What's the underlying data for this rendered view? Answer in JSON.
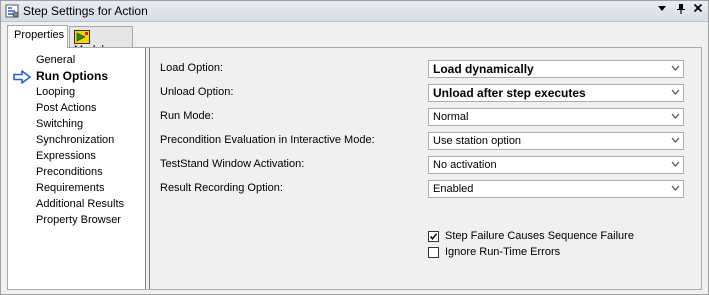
{
  "window": {
    "title": "Step Settings for Action",
    "controls": {
      "dropdown": "▾",
      "pin": "ᚹ",
      "close": "✕"
    }
  },
  "tabs": [
    {
      "label": "Properties",
      "active": true
    },
    {
      "label": "Module",
      "active": false,
      "icon": "labview-module-icon"
    }
  ],
  "nav": {
    "items": [
      {
        "label": "General",
        "selected": false
      },
      {
        "label": "Run Options",
        "selected": true
      },
      {
        "label": "Looping",
        "selected": false
      },
      {
        "label": "Post Actions",
        "selected": false
      },
      {
        "label": "Switching",
        "selected": false
      },
      {
        "label": "Synchronization",
        "selected": false
      },
      {
        "label": "Expressions",
        "selected": false
      },
      {
        "label": "Preconditions",
        "selected": false
      },
      {
        "label": "Requirements",
        "selected": false
      },
      {
        "label": "Additional Results",
        "selected": false
      },
      {
        "label": "Property Browser",
        "selected": false
      }
    ],
    "selected_indicator": "blue-right-arrow-icon"
  },
  "options": [
    {
      "label": "Load Option:",
      "value": "Load dynamically",
      "bold": true
    },
    {
      "label": "Unload Option:",
      "value": "Unload after step executes",
      "bold": true
    },
    {
      "label": "Run Mode:",
      "value": "Normal",
      "bold": false
    },
    {
      "label": "Precondition Evaluation in Interactive Mode:",
      "value": "Use station option",
      "bold": false
    },
    {
      "label": "TestStand Window Activation:",
      "value": "No activation",
      "bold": false
    },
    {
      "label": "Result Recording Option:",
      "value": "Enabled",
      "bold": false
    }
  ],
  "checkboxes": [
    {
      "label": "Step Failure Causes Sequence Failure",
      "checked": true
    },
    {
      "label": "Ignore Run-Time Errors",
      "checked": false
    }
  ],
  "colors": {
    "arrow_blue": "#2a5fd0",
    "panel_bg": "#f0f0f0"
  }
}
